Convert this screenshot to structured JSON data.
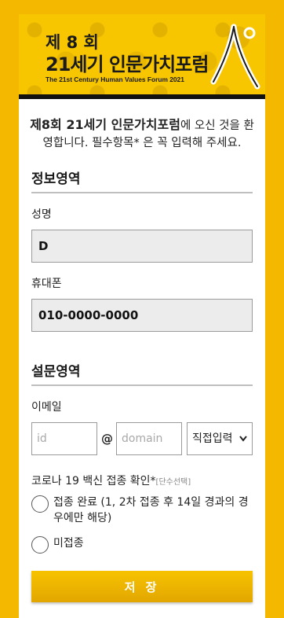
{
  "banner": {
    "edition": "제 8 회",
    "forum_name": "21세기 인문가치포럼",
    "english": "The 21st Century Human Values Forum 2021"
  },
  "intro": {
    "bold": "제8회 21세기 인문가치포럼",
    "rest": "에 오신 것을 환영합니다. 필수항목* 은 꼭 입력해 주세요."
  },
  "info_section": {
    "title": "정보영역",
    "name_label": "성명",
    "name_value": "D",
    "phone_label": "휴대폰",
    "phone_value": "010-0000-0000"
  },
  "survey_section": {
    "title": "설문영역",
    "email_label": "이메일",
    "email_id_placeholder": "id",
    "email_at": "@",
    "email_domain_placeholder": "domain",
    "email_select_value": "직접입력"
  },
  "vaccine": {
    "label": "코로나 19 백신 접종 확인*",
    "hint": "[단수선택]",
    "options": [
      "접종 완료 (1, 2차 접종 후 14일 경과의 경우에만 해당)",
      "미접종"
    ]
  },
  "save_label": "저 장",
  "colors": {
    "background": "#f5b800",
    "button": "#e9b100"
  }
}
